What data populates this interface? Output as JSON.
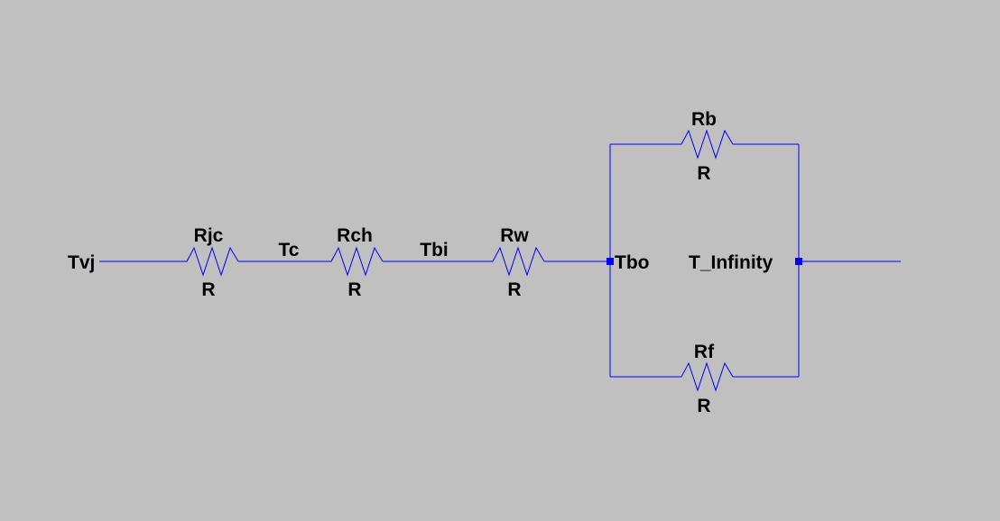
{
  "colors": {
    "background": "#c0c0c0",
    "wire": "#0000ff",
    "text": "#000000"
  },
  "nets": {
    "tvj": "Tvj",
    "tc": "Tc",
    "tbi": "Tbi",
    "tbo": "Tbo",
    "t_infinity": "T_Infinity"
  },
  "resistors": {
    "rjc": {
      "name": "Rjc",
      "value": "R"
    },
    "rch": {
      "name": "Rch",
      "value": "R"
    },
    "rw": {
      "name": "Rw",
      "value": "R"
    },
    "rb": {
      "name": "Rb",
      "value": "R"
    },
    "rf": {
      "name": "Rf",
      "value": "R"
    }
  }
}
